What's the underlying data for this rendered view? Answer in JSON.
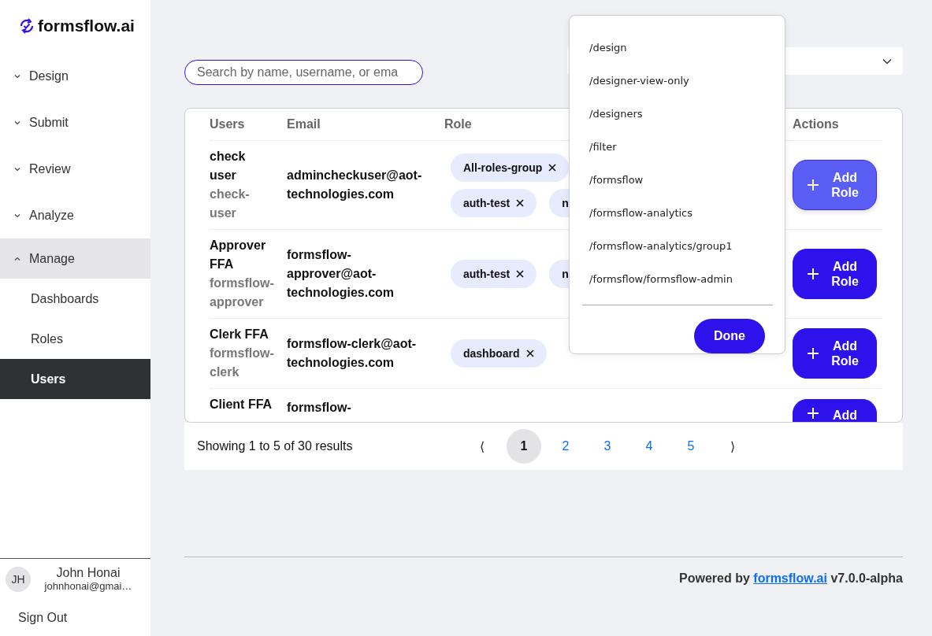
{
  "brand": {
    "name": "formsflow.ai"
  },
  "nav": [
    {
      "label": "Design",
      "expanded": false,
      "selected": false
    },
    {
      "label": "Submit",
      "expanded": false,
      "selected": false
    },
    {
      "label": "Review",
      "expanded": false,
      "selected": false
    },
    {
      "label": "Analyze",
      "expanded": false,
      "selected": false
    },
    {
      "label": "Manage",
      "expanded": true,
      "selected": true,
      "children": [
        {
          "label": "Dashboards",
          "selected": false
        },
        {
          "label": "Roles",
          "selected": false
        },
        {
          "label": "Users",
          "selected": true
        }
      ]
    }
  ],
  "user": {
    "initials": "JH",
    "name": "John Honai",
    "email": "johnhonai@gmai…"
  },
  "sign_out": "Sign Out",
  "search": {
    "placeholder": "Search by name, username, or ema"
  },
  "table": {
    "columns": [
      "Users",
      "Email",
      "Role",
      "Actions"
    ],
    "rows": [
      {
        "name": "check user",
        "username": "check-user",
        "email": "admincheckuser@aot-technologies.com",
        "role_lines": [
          [
            {
              "label": "All-roles-group",
              "kind": "full"
            }
          ],
          [
            {
              "label": "auth-test",
              "kind": "full"
            },
            {
              "label": "n",
              "kind": "cut"
            }
          ]
        ],
        "action": "Add Role",
        "hovered": true
      },
      {
        "name": "Approver FFA",
        "username": "formsflow-approver",
        "email": "formsflow-approver@aot-technologies.com",
        "role_lines": [
          [
            {
              "label": "auth-test",
              "kind": "full"
            },
            {
              "label": "n",
              "kind": "cut"
            }
          ]
        ],
        "action": "Add Role",
        "hovered": false
      },
      {
        "name": "Clerk FFA",
        "username": "formsflow-clerk",
        "email": "formsflow-clerk@aot-technologies.com",
        "role_lines": [
          [
            {
              "label": "dashboard",
              "kind": "full"
            }
          ]
        ],
        "action": "Add Role",
        "hovered": false
      },
      {
        "name": "Client FFA",
        "email": "formsflow-",
        "role_lines": [],
        "action": "Add",
        "hovered": false
      }
    ]
  },
  "pagination": {
    "summary": "Showing 1 to 5 of 30 results",
    "prev": "⟨",
    "next": "⟩",
    "pages": [
      {
        "label": "1",
        "selected": true
      },
      {
        "label": "2",
        "selected": false
      },
      {
        "label": "3",
        "selected": false
      },
      {
        "label": "4",
        "selected": false
      },
      {
        "label": "5",
        "selected": false
      }
    ]
  },
  "dropdown": {
    "options": [
      "/design",
      "/designer-view-only",
      "/designers",
      "/filter",
      "/formsflow",
      "/formsflow-analytics",
      "/formsflow-analytics/group1",
      "/formsflow/formsflow-admin"
    ],
    "done": "Done"
  },
  "footer": {
    "prefix": "Powered by",
    "link": "formsflow.ai",
    "suffix": "v7.0.0-alpha"
  }
}
